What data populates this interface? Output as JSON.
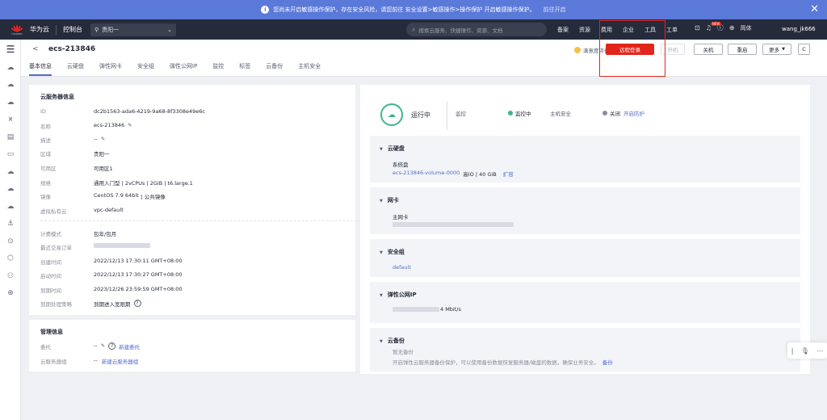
{
  "notice": {
    "text": "您尚未开启敏感操作保护，存在安全风险，请您前往 安全设置>敏感操作>操作保护 开启敏感操作保护。",
    "link": "前往开启",
    "close": "✕"
  },
  "topbar": {
    "logo_caption": "HUAWEI",
    "brand": "华为云",
    "console": "控制台",
    "region": "贵阳一",
    "search_placeholder": "搜索云服务、快捷操作、资源、文档",
    "nav": [
      "备案",
      "资源",
      "费用",
      "企业",
      "工具",
      "工单"
    ],
    "lang": "简体",
    "user": "wang_jk666",
    "new_badge": "NEW"
  },
  "header": {
    "title": "ecs-213846",
    "rating": "满意度评价",
    "buttons": {
      "remote": "远程登录",
      "start": "开机",
      "stop": "关机",
      "restart": "重启",
      "more": "更多",
      "refresh": "C"
    },
    "tabs": [
      "基本信息",
      "云硬盘",
      "弹性网卡",
      "安全组",
      "弹性公网IP",
      "监控",
      "标签",
      "云备份",
      "主机安全"
    ]
  },
  "server_info": {
    "title": "云服务器信息",
    "rows": [
      {
        "k": "ID",
        "v": "dc2b1563-ada6-4219-9a68-8f3308e49e6c"
      },
      {
        "k": "名称",
        "v": "ecs-213846"
      },
      {
        "k": "描述",
        "v": "--"
      },
      {
        "k": "区域",
        "v": "贵阳一"
      },
      {
        "k": "可用区",
        "v": "可用区1"
      },
      {
        "k": "规格",
        "v": "通用入门型 | 2vCPUs | 2GiB | t6.large.1"
      },
      {
        "k": "镜像",
        "v": "CentOS 7.9 64bit",
        "v2": "| 公共镜像"
      },
      {
        "k": "虚拟私有云",
        "v": "vpc-default"
      }
    ],
    "rows2": [
      {
        "k": "计费模式",
        "v": "包年/包月"
      },
      {
        "k": "最近交易订单",
        "v": ""
      },
      {
        "k": "创建时间",
        "v": "2022/12/13 17:30:11 GMT+08:00"
      },
      {
        "k": "启动时间",
        "v": "2022/12/13 17:30:27 GMT+08:00"
      },
      {
        "k": "到期时间",
        "v": "2023/12/26 23:59:59 GMT+08:00"
      },
      {
        "k": "到期处理策略",
        "v": "到期进入宽限期"
      }
    ]
  },
  "mgmt": {
    "title": "管理信息",
    "delegate_k": "委托",
    "delegate_v": "--",
    "delegate_link": "新建委托",
    "group_k": "云服务器组",
    "group_v": "--",
    "group_link": "新建云服务器组"
  },
  "status": {
    "state": "运行中",
    "monitor_k": "监控",
    "monitor_v": "监控中",
    "hss_k": "主机安全",
    "hss_v": "关闭",
    "hss_link": "开启防护",
    "colors": {
      "running": "#3fb58d",
      "off": "#8a8e99"
    }
  },
  "disk": {
    "title": "云硬盘",
    "sys": "系统盘",
    "vol": "ecs-213846-volume-0000",
    "vol_info": "高IO | 40 GiB",
    "expand": "扩容"
  },
  "nic": {
    "title": "网卡",
    "main": "主网卡"
  },
  "sg": {
    "title": "安全组",
    "name": "default"
  },
  "eip": {
    "title": "弹性公网IP",
    "bw": "4 Mbit/s"
  },
  "backup": {
    "title": "云备份",
    "none": "暂无备份",
    "desc": "开启弹性云服务器备份保护，可以使用备份数据恢复服务器/磁盘的数据，确保业务安全。",
    "link": "备份"
  },
  "accent": "#e1251b",
  "link_color": "#526ecc"
}
